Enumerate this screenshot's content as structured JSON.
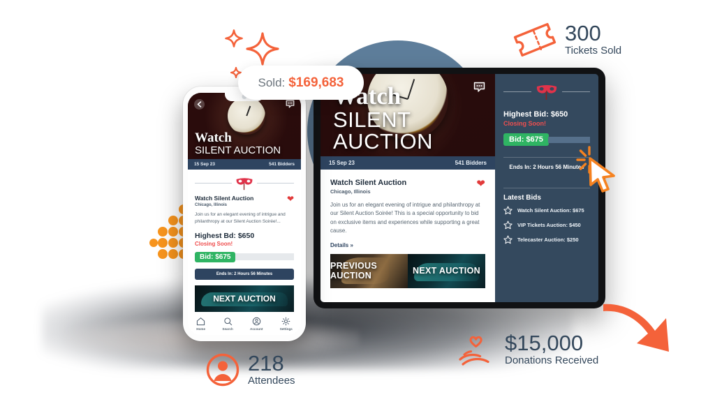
{
  "badge": {
    "label": "Sold:",
    "value": "$169,683"
  },
  "callouts": [
    {
      "icon": "ticket-icon",
      "value": "300",
      "label": "Tickets Sold"
    },
    {
      "icon": "attendee-icon",
      "value": "218",
      "label": "Attendees"
    },
    {
      "icon": "donation-hands-icon",
      "value": "$15,000",
      "label": "Donations Received"
    }
  ],
  "tablet": {
    "hero": {
      "title_line1": "Watch",
      "title_line2": "SILENT AUCTION"
    },
    "meta": {
      "date": "15 Sep 23",
      "bidders": "541 Bidders"
    },
    "listing": {
      "title": "Watch Silent Auction",
      "location": "Chicago, Illinois",
      "description": "Join us for an elegant evening of intrigue and philanthropy at our Silent Auction Soirée! This is a special opportunity to bid on exclusive items and experiences while supporting a great cause.",
      "details_link": "Details »"
    },
    "thumbs": {
      "previous": "PREVIOUS AUCTION",
      "next": "NEXT AUCTION"
    },
    "sidebar": {
      "highest_bid": "Highest Bid: $650",
      "closing": "Closing Soon!",
      "bid_button": "Bid: $675",
      "ends_in": "Ends In: 2 Hours 56 Minutes",
      "latest_bids_title": "Latest Bids",
      "latest_bids": [
        "Watch Silent Auction: $675",
        "VIP Tickets Auction: $450",
        "Telecaster Auction: $250"
      ]
    }
  },
  "phone": {
    "hero": {
      "title_line1": "Watch",
      "title_line2": "SILENT AUCTION"
    },
    "meta": {
      "date": "15 Sep 23",
      "bidders": "541 Bidders"
    },
    "listing": {
      "title": "Watch Silent Auction",
      "location": "Chicago, Illinois",
      "description": "Join us for an elegant evening of intrigue and philanthropy at our Silent Auction Soirée!...",
      "highest_bid": "Highest Bd: $650",
      "closing": "Closing Soon!",
      "bid_button": "Bid: $675",
      "ends_in": "Ends In: 2 Hours 56 Minutes"
    },
    "next_auction": "NEXT AUCTION",
    "nav": [
      {
        "icon": "home-icon",
        "label": "Home"
      },
      {
        "icon": "search-icon",
        "label": "Search"
      },
      {
        "icon": "account-icon",
        "label": "Account"
      },
      {
        "icon": "settings-gear-icon",
        "label": "Settings"
      }
    ]
  },
  "colors": {
    "accent_orange": "#f4623a",
    "navy": "#34495e",
    "green": "#2fb463",
    "red": "#ef4f4f",
    "steel_blue": "#5e7e9b"
  }
}
